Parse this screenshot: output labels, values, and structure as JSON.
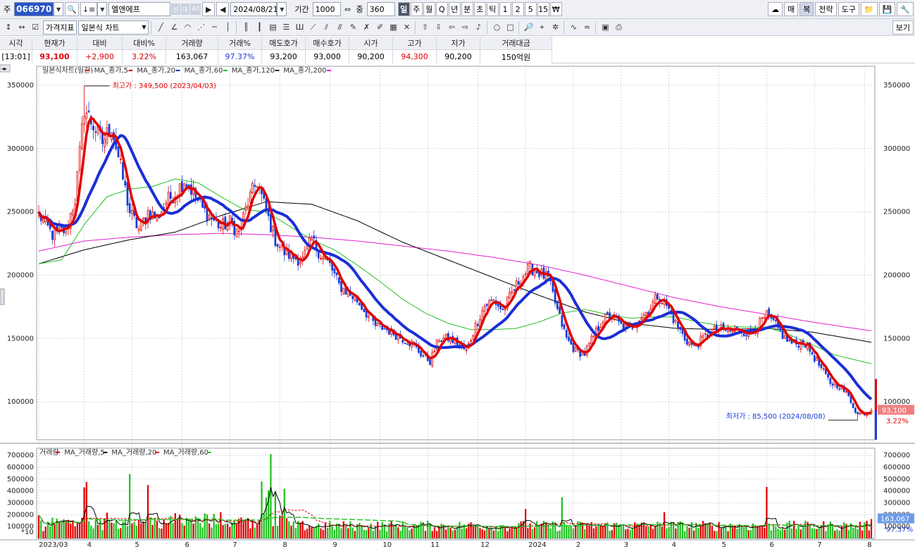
{
  "toolbar": {
    "code_label": "주",
    "code_value": "066970",
    "stock_name": "엘앤에프",
    "tag_credit": "신",
    "tag_loan": "대",
    "tag_margin": "40",
    "date": "2024/08/21",
    "period_label": "기간",
    "period_value": "1000",
    "count_label": "중",
    "count_value": "360",
    "periods": [
      "일",
      "주",
      "월",
      "Q",
      "년",
      "분",
      "초",
      "틱",
      "1",
      "2",
      "5",
      "15",
      "₩"
    ],
    "active_period": "일",
    "right_buttons": [
      "매",
      "복",
      "전략",
      "도구"
    ],
    "active_right": "복"
  },
  "toolbar2": {
    "indicator_label": "가격지표",
    "chart_type": "일본식 차트",
    "view_label": "보기"
  },
  "quote": {
    "headers": [
      "시각",
      "현재가",
      "대비",
      "대비%",
      "거래량",
      "거래%",
      "매도호가",
      "매수호가",
      "시가",
      "고가",
      "저가",
      "거래대금"
    ],
    "values": [
      "[13:01]",
      "93,100",
      "+2,900",
      "3.22%",
      "163,067",
      "97.37%",
      "93,200",
      "93,000",
      "90,200",
      "94,300",
      "90,200",
      "150억원"
    ]
  },
  "legend": {
    "price": [
      {
        "name": "일본식차트(일간)",
        "color": "#e00000"
      },
      {
        "name": "MA_종가,5",
        "color": "#e00000"
      },
      {
        "name": "MA_종가,20",
        "color": "#1a2fd6"
      },
      {
        "name": "MA_종가,60",
        "color": "#22c022"
      },
      {
        "name": "MA_종가,120",
        "color": "#000000"
      },
      {
        "name": "MA_종가,200",
        "color": "#e020d0"
      }
    ],
    "volume": [
      {
        "name": "거래량",
        "color": "#e00000"
      },
      {
        "name": "MA_거래량,5",
        "color": "#000000"
      },
      {
        "name": "MA_거래량,20",
        "color": "#e00000"
      },
      {
        "name": "MA_거래량,60",
        "color": "#22c022"
      }
    ]
  },
  "annotations": {
    "high": "최고가 : 349,500 (2023/04/03)",
    "low": "최저가 : 85,500 (2024/08/08)",
    "last_price": "93,100",
    "last_change": "3.22%",
    "last_volume": "163,067",
    "last_volume_pct": "97.37%",
    "volume_scale": "*10"
  },
  "chart_data": {
    "type": "candlestick",
    "price_axis": {
      "ylim": [
        70000,
        365000
      ],
      "ticks": [
        "350000",
        "300000",
        "250000",
        "200000",
        "150000",
        "100000"
      ]
    },
    "volume_axis": {
      "ylim": [
        0,
        760000
      ],
      "ticks": [
        "700000",
        "600000",
        "500000",
        "400000",
        "300000",
        "200000",
        "100000"
      ]
    },
    "x_labels": [
      "2023/03",
      "4",
      "5",
      "6",
      "7",
      "8",
      "9",
      "10",
      "11",
      "12",
      "2024",
      "2",
      "3",
      "4",
      "5",
      "6",
      "7",
      "8"
    ],
    "x_label_index": [
      0,
      20,
      41,
      63,
      84,
      106,
      128,
      150,
      171,
      193,
      214,
      235,
      256,
      277,
      299,
      320,
      341,
      363
    ],
    "close_anchors": [
      [
        0,
        248000
      ],
      [
        6,
        232000
      ],
      [
        12,
        236000
      ],
      [
        16,
        260000
      ],
      [
        20,
        332000
      ],
      [
        24,
        318000
      ],
      [
        28,
        305000
      ],
      [
        32,
        318000
      ],
      [
        36,
        285000
      ],
      [
        40,
        250000
      ],
      [
        44,
        236000
      ],
      [
        48,
        250000
      ],
      [
        52,
        245000
      ],
      [
        56,
        258000
      ],
      [
        60,
        265000
      ],
      [
        64,
        275000
      ],
      [
        68,
        265000
      ],
      [
        72,
        252000
      ],
      [
        76,
        245000
      ],
      [
        80,
        238000
      ],
      [
        84,
        242000
      ],
      [
        88,
        233000
      ],
      [
        92,
        258000
      ],
      [
        96,
        274000
      ],
      [
        100,
        250000
      ],
      [
        104,
        228000
      ],
      [
        108,
        218000
      ],
      [
        112,
        214000
      ],
      [
        116,
        212000
      ],
      [
        120,
        228000
      ],
      [
        124,
        216000
      ],
      [
        128,
        208000
      ],
      [
        132,
        192000
      ],
      [
        136,
        186000
      ],
      [
        140,
        180000
      ],
      [
        144,
        170000
      ],
      [
        148,
        160000
      ],
      [
        152,
        158000
      ],
      [
        156,
        154000
      ],
      [
        160,
        150000
      ],
      [
        164,
        146000
      ],
      [
        168,
        138000
      ],
      [
        172,
        132000
      ],
      [
        176,
        150000
      ],
      [
        180,
        150000
      ],
      [
        184,
        146000
      ],
      [
        188,
        140000
      ],
      [
        192,
        160000
      ],
      [
        196,
        176000
      ],
      [
        200,
        180000
      ],
      [
        204,
        172000
      ],
      [
        208,
        186000
      ],
      [
        212,
        198000
      ],
      [
        216,
        206000
      ],
      [
        220,
        202000
      ],
      [
        224,
        197000
      ],
      [
        228,
        172000
      ],
      [
        232,
        150000
      ],
      [
        236,
        140000
      ],
      [
        240,
        138000
      ],
      [
        244,
        152000
      ],
      [
        248,
        165000
      ],
      [
        252,
        168000
      ],
      [
        256,
        160000
      ],
      [
        260,
        158000
      ],
      [
        264,
        166000
      ],
      [
        268,
        172000
      ],
      [
        272,
        184000
      ],
      [
        276,
        176000
      ],
      [
        280,
        162000
      ],
      [
        284,
        150000
      ],
      [
        288,
        143000
      ],
      [
        292,
        150000
      ],
      [
        296,
        156000
      ],
      [
        300,
        157000
      ],
      [
        304,
        156000
      ],
      [
        308,
        157000
      ],
      [
        312,
        154000
      ],
      [
        316,
        160000
      ],
      [
        320,
        168000
      ],
      [
        324,
        160000
      ],
      [
        328,
        150000
      ],
      [
        332,
        145000
      ],
      [
        336,
        148000
      ],
      [
        340,
        138000
      ],
      [
        344,
        126000
      ],
      [
        348,
        115000
      ],
      [
        352,
        113000
      ],
      [
        356,
        104000
      ],
      [
        360,
        90000
      ],
      [
        364,
        92000
      ],
      [
        366,
        93100
      ]
    ],
    "ma120_anchors": [
      [
        0,
        209000
      ],
      [
        20,
        220000
      ],
      [
        40,
        228000
      ],
      [
        60,
        234000
      ],
      [
        80,
        247000
      ],
      [
        100,
        258000
      ],
      [
        120,
        256000
      ],
      [
        140,
        243000
      ],
      [
        160,
        226000
      ],
      [
        180,
        212000
      ],
      [
        200,
        198000
      ],
      [
        220,
        184000
      ],
      [
        240,
        171000
      ],
      [
        260,
        162000
      ],
      [
        280,
        158000
      ],
      [
        300,
        157000
      ],
      [
        320,
        158000
      ],
      [
        340,
        155000
      ],
      [
        366,
        147000
      ]
    ],
    "ma200_anchors": [
      [
        0,
        219000
      ],
      [
        20,
        227000
      ],
      [
        40,
        230000
      ],
      [
        60,
        232000
      ],
      [
        80,
        233000
      ],
      [
        100,
        232000
      ],
      [
        120,
        230000
      ],
      [
        140,
        227000
      ],
      [
        160,
        223000
      ],
      [
        180,
        219000
      ],
      [
        200,
        214000
      ],
      [
        220,
        208000
      ],
      [
        240,
        200000
      ],
      [
        260,
        191000
      ],
      [
        280,
        182000
      ],
      [
        300,
        175000
      ],
      [
        320,
        169000
      ],
      [
        340,
        163000
      ],
      [
        366,
        156000
      ]
    ],
    "ma60_anchors": [
      [
        0,
        209000
      ],
      [
        10,
        212000
      ],
      [
        20,
        240000
      ],
      [
        30,
        262000
      ],
      [
        40,
        268000
      ],
      [
        50,
        270000
      ],
      [
        60,
        276000
      ],
      [
        70,
        273000
      ],
      [
        80,
        262000
      ],
      [
        90,
        252000
      ],
      [
        100,
        250000
      ],
      [
        110,
        239000
      ],
      [
        120,
        228000
      ],
      [
        130,
        220000
      ],
      [
        140,
        208000
      ],
      [
        150,
        195000
      ],
      [
        160,
        181000
      ],
      [
        170,
        170000
      ],
      [
        180,
        162000
      ],
      [
        190,
        157000
      ],
      [
        200,
        157000
      ],
      [
        210,
        158000
      ],
      [
        220,
        163000
      ],
      [
        230,
        170000
      ],
      [
        240,
        173000
      ],
      [
        250,
        169000
      ],
      [
        260,
        166000
      ],
      [
        270,
        167000
      ],
      [
        280,
        167000
      ],
      [
        290,
        163000
      ],
      [
        300,
        160000
      ],
      [
        310,
        159000
      ],
      [
        320,
        159000
      ],
      [
        330,
        153000
      ],
      [
        340,
        145000
      ],
      [
        350,
        137000
      ],
      [
        366,
        130000
      ]
    ]
  }
}
